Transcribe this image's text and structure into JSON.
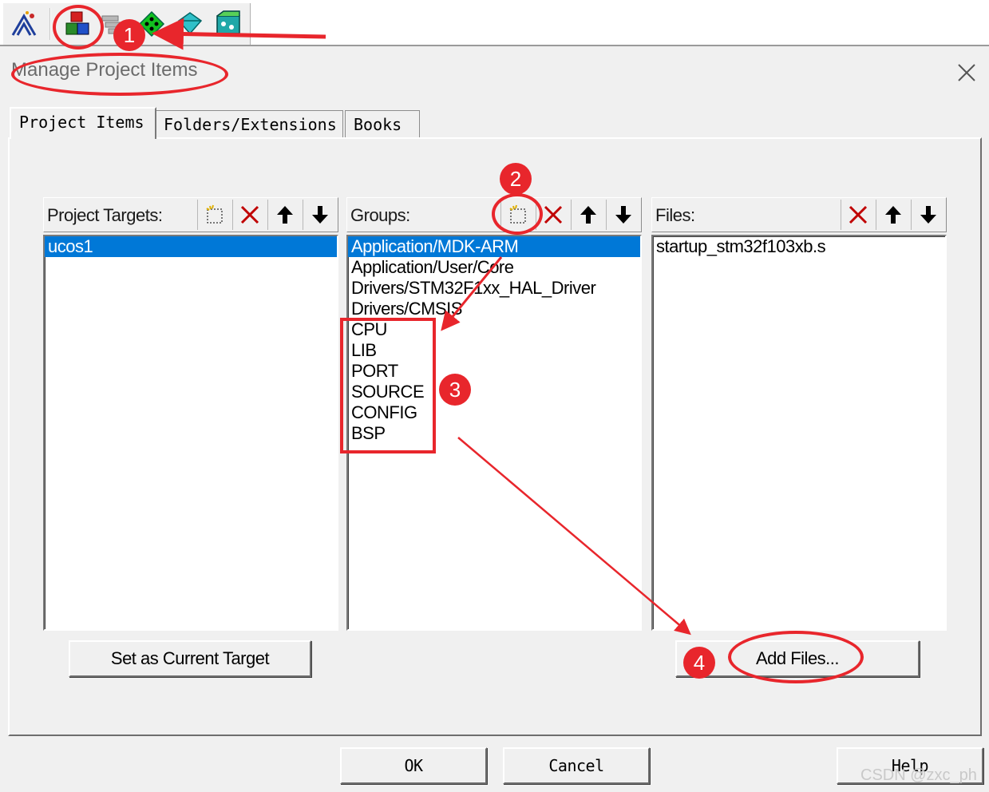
{
  "toolbar": {
    "icons": [
      "batch-build-icon",
      "manage-project-items-icon",
      "target-options-icon",
      "select-device-icon",
      "manage-components-icon"
    ]
  },
  "dialog": {
    "title": "Manage Project Items",
    "tabs": [
      {
        "label": "Project Items",
        "active": true
      },
      {
        "label": "Folders/Extensions",
        "active": false
      },
      {
        "label": "Books",
        "active": false
      }
    ]
  },
  "targets": {
    "label": "Project Targets:",
    "items": [
      "ucos1"
    ],
    "selected_index": 0,
    "set_current_label": "Set as Current Target"
  },
  "groups": {
    "label": "Groups:",
    "items": [
      "Application/MDK-ARM",
      "Application/User/Core",
      "Drivers/STM32F1xx_HAL_Driver",
      "Drivers/CMSIS",
      "CPU",
      "LIB",
      "PORT",
      "SOURCE",
      "CONFIG",
      "BSP"
    ],
    "selected_index": 0
  },
  "files": {
    "label": "Files:",
    "items": [
      "startup_stm32f103xb.s"
    ],
    "add_files_label": "Add Files..."
  },
  "footer": {
    "ok_label": "OK",
    "cancel_label": "Cancel",
    "help_label": "Help"
  },
  "annotations": {
    "badge1": "1",
    "badge2": "2",
    "badge3": "3",
    "badge4": "4",
    "color": "#e8262c"
  },
  "watermark": "CSDN @zxc_ph",
  "colors": {
    "selection": "#0078d7",
    "dialog_bg": "#f0f0f0"
  }
}
